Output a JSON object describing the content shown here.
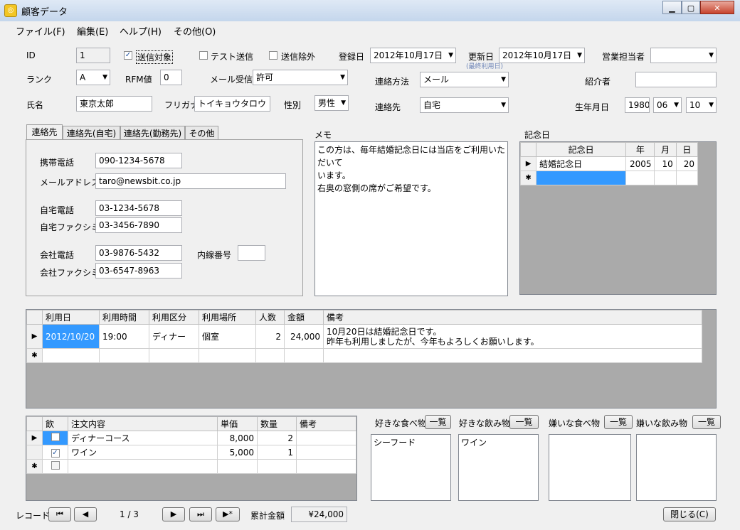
{
  "window": {
    "title": "顧客データ",
    "min": "▁",
    "max": "▢",
    "close": "✕"
  },
  "menu": [
    "ファイル(F)",
    "編集(E)",
    "ヘルプ(H)",
    "その他(O)"
  ],
  "form": {
    "id_label": "ID",
    "id_value": "1",
    "send_target_label": "送信対象",
    "send_target_checked": true,
    "test_send_label": "テスト送信",
    "test_send_checked": false,
    "exclude_label": "送信除外",
    "exclude_checked": false,
    "reg_date_label": "登録日",
    "reg_date_value": "2012年10月17日",
    "upd_date_label": "更新日",
    "upd_date_value": "2012年10月17日",
    "upd_date_hint": "(最終利用日)",
    "sales_label": "営業担当者",
    "sales_value": "",
    "rank_label": "ランク",
    "rank_value": "A",
    "rfm_label": "RFM値",
    "rfm_value": "0",
    "mail_label": "メール受信",
    "mail_value": "許可",
    "contact_method_label": "連絡方法",
    "contact_method_value": "メール",
    "referrer_label": "紹介者",
    "referrer_value": "",
    "name_label": "氏名",
    "name_value": "東京太郎",
    "kana_label": "フリガナ",
    "kana_value": "トイキョウタロウ",
    "gender_label": "性別",
    "gender_value": "男性",
    "contact_label": "連絡先",
    "contact_value": "自宅",
    "birth_label": "生年月日",
    "birth_year": "1980",
    "birth_month": "06",
    "birth_day": "10"
  },
  "tabs": [
    "連絡先",
    "連絡先(自宅)",
    "連絡先(勤務先)",
    "その他"
  ],
  "contact_tab": {
    "mobile_label": "携帯電話",
    "mobile_value": "090-1234-5678",
    "email_label": "メールアドレス",
    "email_value": "taro@newsbit.co.jp",
    "home_tel_label": "自宅電話",
    "home_tel_value": "03-1234-5678",
    "home_fax_label": "自宅ファクシミリ",
    "home_fax_value": "03-3456-7890",
    "work_tel_label": "会社電話",
    "work_tel_value": "03-9876-5432",
    "ext_label": "内線番号",
    "ext_value": "",
    "work_fax_label": "会社ファクシミリ",
    "work_fax_value": "03-6547-8963"
  },
  "memo": {
    "label": "メモ",
    "text": "この方は、毎年結婚記念日には当店をご利用いただいて\nいます。\n右奥の窓側の席がご希望です。"
  },
  "anniversary": {
    "label": "記念日",
    "headers": [
      "記念日",
      "年",
      "月",
      "日"
    ],
    "rows": [
      [
        "結婚記念日",
        "2005",
        "10",
        "20"
      ]
    ]
  },
  "usage": {
    "headers": [
      "利用日",
      "利用時間",
      "利用区分",
      "利用場所",
      "人数",
      "金額",
      "備考"
    ],
    "rows": [
      [
        "2012/10/20",
        "19:00",
        "ディナー",
        "個室",
        "2",
        "24,000",
        "10月20日は結婚記念日です。\n昨年も利用しましたが、今年もよろしくお願いします。"
      ]
    ]
  },
  "orders": {
    "headers": [
      "飲",
      "注文内容",
      "単価",
      "数量",
      "備考"
    ],
    "rows": [
      {
        "drink": false,
        "item": "ディナーコース",
        "price": "8,000",
        "qty": "2",
        "note": ""
      },
      {
        "drink": true,
        "item": "ワイン",
        "price": "5,000",
        "qty": "1",
        "note": ""
      }
    ]
  },
  "prefs": {
    "list_btn": "一覧",
    "likes_food_label": "好きな食べ物",
    "likes_food_value": "シーフード",
    "likes_drink_label": "好きな飲み物",
    "likes_drink_value": "ワイン",
    "dislikes_food_label": "嫌いな食べ物",
    "dislikes_food_value": "",
    "dislikes_drink_label": "嫌いな飲み物",
    "dislikes_drink_value": ""
  },
  "footer": {
    "record_label": "レコード:",
    "position": "1 / 3",
    "nav_first": "⏮",
    "nav_prev": "◀",
    "nav_next": "▶",
    "nav_last": "⏭",
    "nav_new": "▶*",
    "total_label": "累計金額",
    "total_value": "¥24,000",
    "close_btn": "閉じる(C)"
  },
  "colors": {
    "selection": "#3399ff",
    "gray_area": "#aaaaaa",
    "accent_hint": "#6f86b8"
  }
}
